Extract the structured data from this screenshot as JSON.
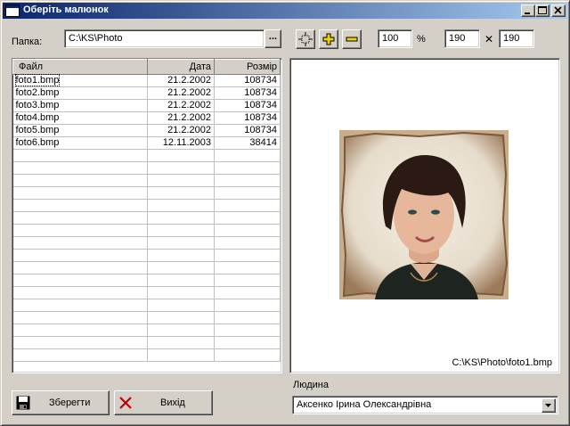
{
  "window": {
    "title": "Оберіть малюнок"
  },
  "folder": {
    "label": "Папка:",
    "value": "C:\\KS\\Photo",
    "browse_label": "..."
  },
  "zoom": {
    "percent": "100",
    "percent_sign": "%",
    "width": "190",
    "times": "✕",
    "height": "190"
  },
  "toolbar": {
    "icons": [
      "fit-icon",
      "zoom-in-icon",
      "zoom-out-icon"
    ]
  },
  "table": {
    "columns": [
      "Файл",
      "Дата",
      "Розмір"
    ],
    "rows": [
      [
        "foto1.bmp",
        "21.2.2002",
        "108734"
      ],
      [
        "foto2.bmp",
        "21.2.2002",
        "108734"
      ],
      [
        "foto3.bmp",
        "21.2.2002",
        "108734"
      ],
      [
        "foto4.bmp",
        "21.2.2002",
        "108734"
      ],
      [
        "foto5.bmp",
        "21.2.2002",
        "108734"
      ],
      [
        "foto6.bmp",
        "12.11.2003",
        "38414"
      ]
    ]
  },
  "preview": {
    "path": "C:\\KS\\Photo\\foto1.bmp"
  },
  "buttons": {
    "save": "Зберегти",
    "exit": "Вихід"
  },
  "person": {
    "label": "Людина",
    "value": "Аксенко Ірина Олександрівна"
  },
  "colors": {
    "titlebar_start": "#0a246a",
    "titlebar_end": "#a6caf0",
    "face": "#d4d0c8"
  }
}
